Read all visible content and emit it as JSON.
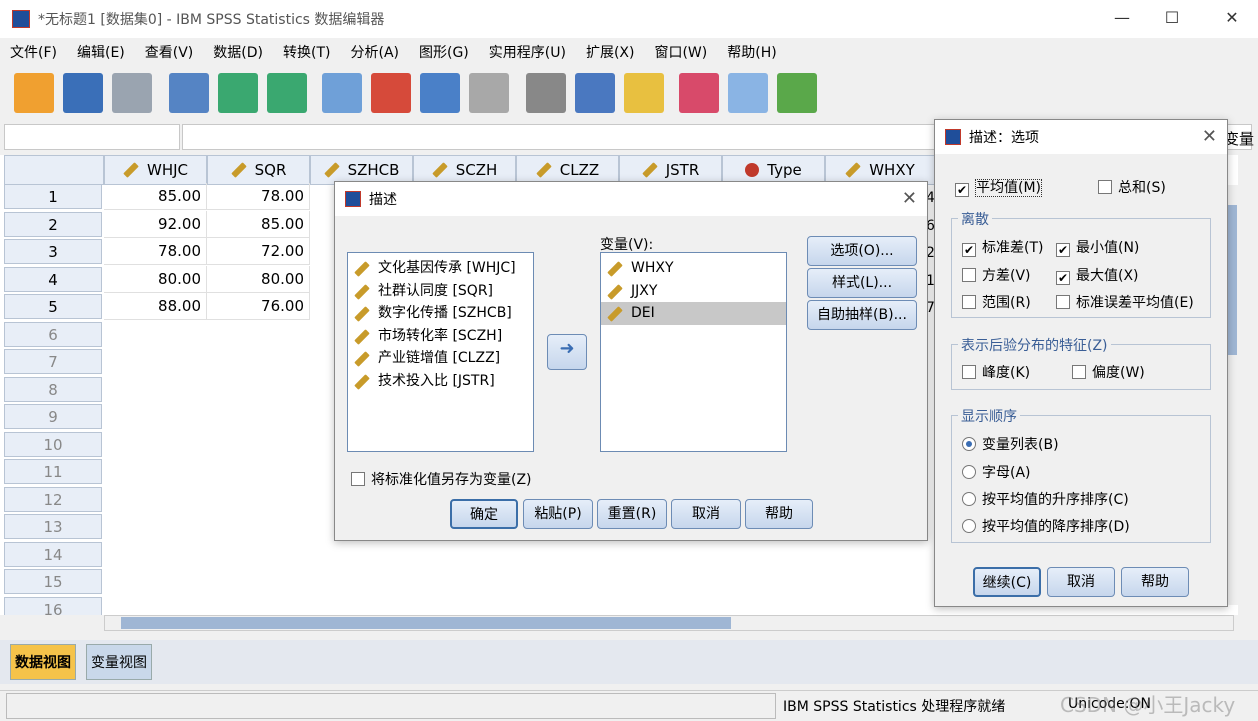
{
  "window": {
    "title": "*无标题1 [数据集0] - IBM SPSS Statistics 数据编辑器"
  },
  "menu": [
    "文件(F)",
    "编辑(E)",
    "查看(V)",
    "数据(D)",
    "转换(T)",
    "分析(A)",
    "图形(G)",
    "实用程序(U)",
    "扩展(X)",
    "窗口(W)",
    "帮助(H)"
  ],
  "toolbar": {
    "icons": [
      "open-folder-icon",
      "save-icon",
      "print-icon",
      "recall-dialog-icon",
      "undo-icon",
      "redo-icon",
      "goto-case-icon",
      "goto-variable-icon",
      "variables-icon",
      "find-icon",
      "insert-cases-icon",
      "insert-variable-icon",
      "split-file-icon",
      "weight-cases-icon",
      "select-cases-icon",
      "value-labels-icon",
      "use-sets-icon"
    ]
  },
  "grid": {
    "columns": [
      "WHJC",
      "SQR",
      "SZHCB",
      "SCZH",
      "CLZZ",
      "JSTR",
      "Type",
      "WHXY"
    ],
    "rows": [
      [
        "85.00",
        "78.00"
      ],
      [
        "92.00",
        "85.00"
      ],
      [
        "78.00",
        "72.00"
      ],
      [
        "80.00",
        "80.00"
      ],
      [
        "88.00",
        "76.00"
      ]
    ],
    "row_numbers": [
      "1",
      "2",
      "3",
      "4",
      "5",
      "6",
      "7",
      "8",
      "9",
      "10",
      "11",
      "12",
      "13",
      "14",
      "15",
      "16"
    ],
    "partial_right": [
      "4",
      "6",
      "2",
      "1",
      "7"
    ],
    "right_label": "变量"
  },
  "view_tabs": {
    "data": "数据视图",
    "variable": "变量视图"
  },
  "status": {
    "processor": "IBM SPSS Statistics 处理程序就绪",
    "encoding": "Unicode:ON",
    "watermark": "CSDN @小王Jacky"
  },
  "desc_dialog": {
    "title": "描述",
    "source_vars": [
      "文化基因传承 [WHJC]",
      "社群认同度 [SQR]",
      "数字化传播 [SZHCB]",
      "市场转化率 [SCZH]",
      "产业链增值 [CLZZ]",
      "技术投入比 [JSTR]"
    ],
    "target_label": "变量(V):",
    "target_vars": [
      "WHXY",
      "JJXY",
      "DEI"
    ],
    "side_buttons": [
      "选项(O)...",
      "样式(L)...",
      "自助抽样(B)..."
    ],
    "save_std": "将标准化值另存为变量(Z)",
    "buttons": [
      "确定",
      "粘贴(P)",
      "重置(R)",
      "取消",
      "帮助"
    ]
  },
  "opt_dialog": {
    "title": "描述：选项",
    "mean": "平均值(M)",
    "sum": "总和(S)",
    "dispersion": {
      "legend": "离散",
      "items": [
        "标准差(T)",
        "最小值(N)",
        "方差(V)",
        "最大值(X)",
        "范围(R)",
        "标准误差平均值(E)"
      ]
    },
    "distribution": {
      "legend": "表示后验分布的特征(Z)",
      "items": [
        "峰度(K)",
        "偏度(W)"
      ]
    },
    "order": {
      "legend": "显示顺序",
      "items": [
        "变量列表(B)",
        "字母(A)",
        "按平均值的升序排序(C)",
        "按平均值的降序排序(D)"
      ]
    },
    "buttons": [
      "继续(C)",
      "取消",
      "帮助"
    ]
  }
}
